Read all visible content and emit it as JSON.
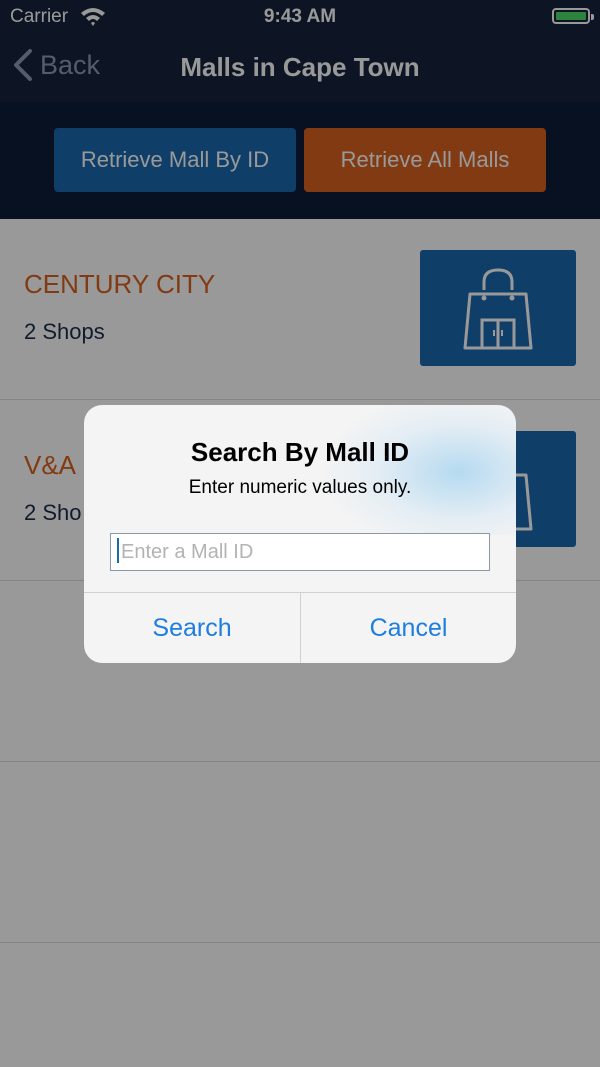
{
  "status_bar": {
    "carrier": "Carrier",
    "time": "9:43 AM"
  },
  "nav": {
    "back_label": "Back",
    "title": "Malls in Cape Town"
  },
  "toolbar": {
    "retrieve_by_id_label": "Retrieve Mall By ID",
    "retrieve_all_label": "Retrieve All Malls"
  },
  "malls": [
    {
      "name": "CENTURY CITY",
      "shops": "2 Shops"
    },
    {
      "name": "V&A",
      "shops": "2 Sho"
    }
  ],
  "alert": {
    "title": "Search By Mall ID",
    "message": "Enter numeric values only.",
    "input_placeholder": "Enter a Mall ID",
    "search_label": "Search",
    "cancel_label": "Cancel"
  },
  "colors": {
    "nav_bg": "#17243d",
    "toolbar_bg": "#0d1d38",
    "primary_blue": "#1a6aae",
    "accent_orange": "#d9621f",
    "alert_button_blue": "#1c7ee0"
  },
  "icons": [
    "wifi-icon",
    "battery-icon",
    "back-chevron-icon",
    "shopping-bag-icon"
  ]
}
